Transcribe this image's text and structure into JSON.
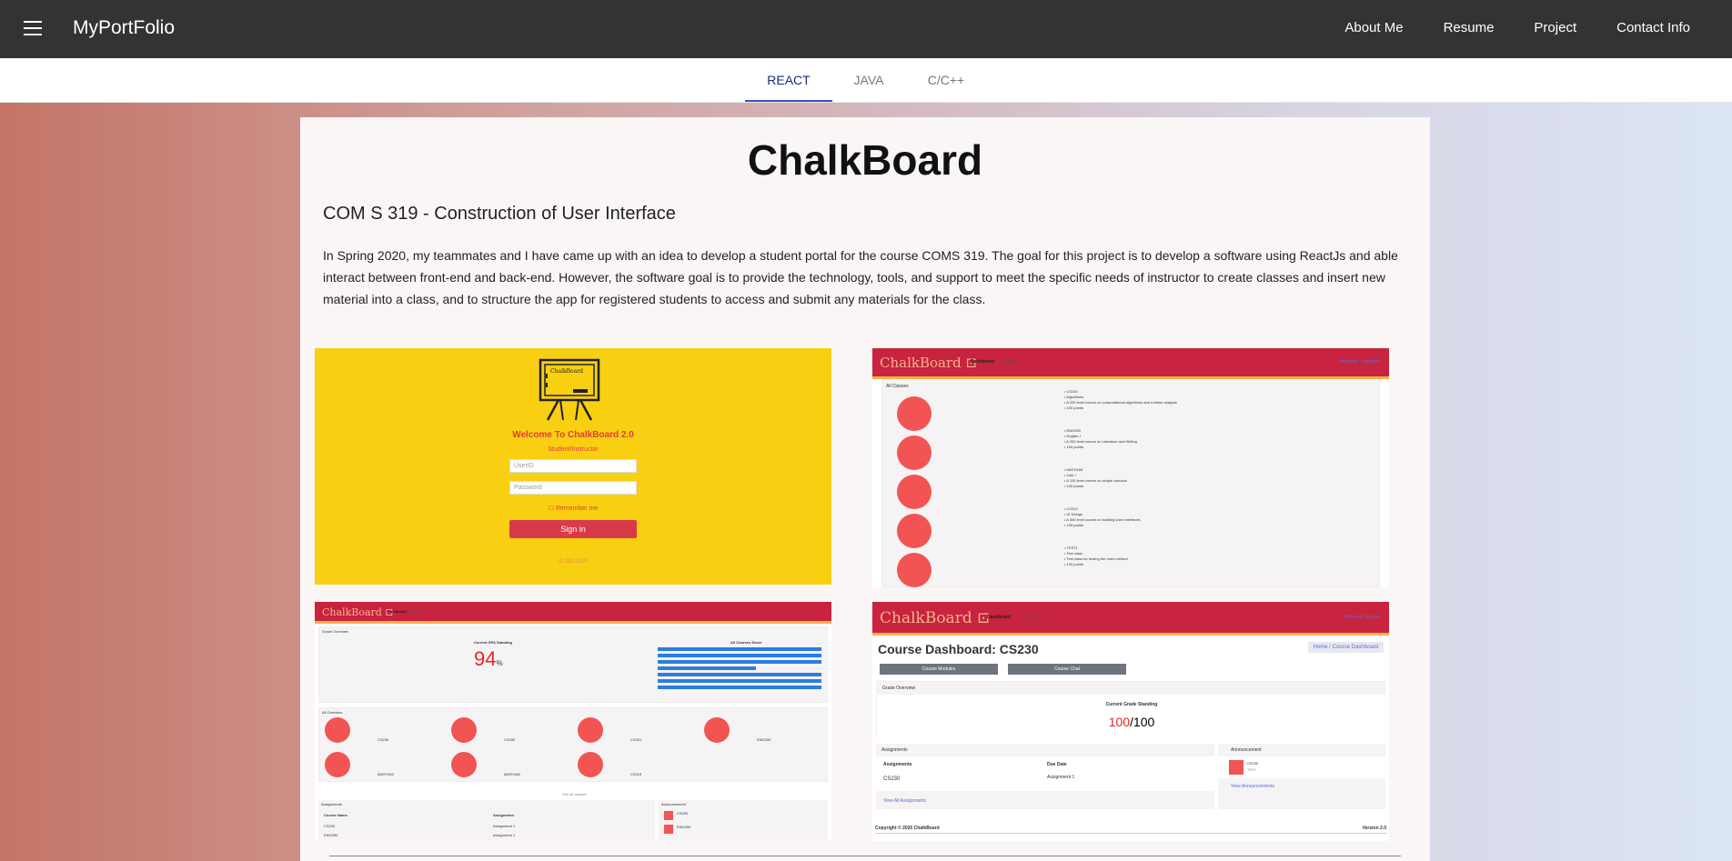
{
  "navbar": {
    "brand": "MyPortFolio",
    "links": [
      "About Me",
      "Resume",
      "Project",
      "Contact Info"
    ]
  },
  "tabs": [
    "REACT",
    "JAVA",
    "C/C++"
  ],
  "active_tab": "REACT",
  "project": {
    "title": "ChalkBoard",
    "subtitle": "COM S 319 - Construction of User Interface",
    "description": "In Spring 2020, my teammates and I have came up with an idea to develop a student portal for the course COMS 319. The goal for this project is to develop a software using ReactJs and able interact between front-end and back-end. However, the software goal is to provide the technology, tools, and support to meet the specific needs of instructor to create classes and insert new material into a class, and to structure the app for registered students to access and submit any materials for the class."
  },
  "shot1": {
    "board_label": "ChalkBoard",
    "welcome": "Welcome To ChalkBoard 2.0",
    "role": "Student/Instructor",
    "userid_placeholder": "UserID",
    "password_placeholder": "Password",
    "remember": "Remember me",
    "signin": "Sign in",
    "copyright": "© 319 2020"
  },
  "shot2": {
    "logo": "ChalkBoard",
    "nav1": "Dashboard",
    "nav2": "Classes",
    "right": "Welcome, Instructor",
    "panel_title": "All Classes",
    "classes": [
      [
        "CS230",
        "Algorithms",
        "A 200 level course on computational algorithms and runtime analysis",
        "100 points"
      ],
      [
        "ENG250",
        "English I",
        "A 200 level course on Literature and Writing",
        "100 points"
      ],
      [
        "MATH165",
        "Calc I",
        "A 100 level course on simple calculus",
        "100 points"
      ],
      [
        "CS319",
        "UI Design",
        "A 300 level course on building User Interfaces",
        "100 points"
      ],
      [
        "TEST1",
        "Test class",
        "Test class for testing the roles method",
        "100 points"
      ]
    ]
  },
  "shot3": {
    "logo": "ChalkBoard",
    "nav1": "Dashboard",
    "nav2": "Classes",
    "grade_overview": "Grade Overview",
    "gpa_label": "Current GPA Standing",
    "gpa_value": "94",
    "gpa_unit": "%",
    "all_courses": "All Courses Score",
    "all_overview": "All Overview",
    "course_labels": [
      "CS230",
      "CS330",
      "CS331",
      "ENG250",
      "MATH165",
      "MATH166",
      "CS319"
    ],
    "see_all": "See all classes",
    "assignments": "Assignments",
    "announcement": "Announcement",
    "col_course": "Course Name",
    "col_assign": "Assignment",
    "rows": [
      [
        "CS230",
        "Assignment 1"
      ],
      [
        "ENG250",
        "Assignment 1"
      ]
    ],
    "ann_items": [
      "CS230",
      "ENG250"
    ]
  },
  "shot4": {
    "logo": "ChalkBoard",
    "nav1": "Dashboard",
    "nav2": "Classes",
    "right": "Welcome, Student",
    "heading": "Course Dashboard: CS230",
    "breadcrumb": "Home / Course Dashboard",
    "btn1": "Course Modules",
    "btn2": "Course Chat",
    "grade_overview": "Grade Overview",
    "standing": "Current Grade Standing",
    "score": "100",
    "total": "/100",
    "assignments": "Assignments",
    "col1": "Assignments",
    "col2": "Due Date",
    "row1": "CS230",
    "row2": "Assignment 1",
    "view_all": "View All Assignments",
    "announcement": "Announcement",
    "ann_title": "CS230",
    "ann_text": "TEST",
    "view_ann": "View Announcements",
    "footer_left": "Copyright © 2020 ChalkBoard",
    "footer_right": "Version 2.0"
  }
}
